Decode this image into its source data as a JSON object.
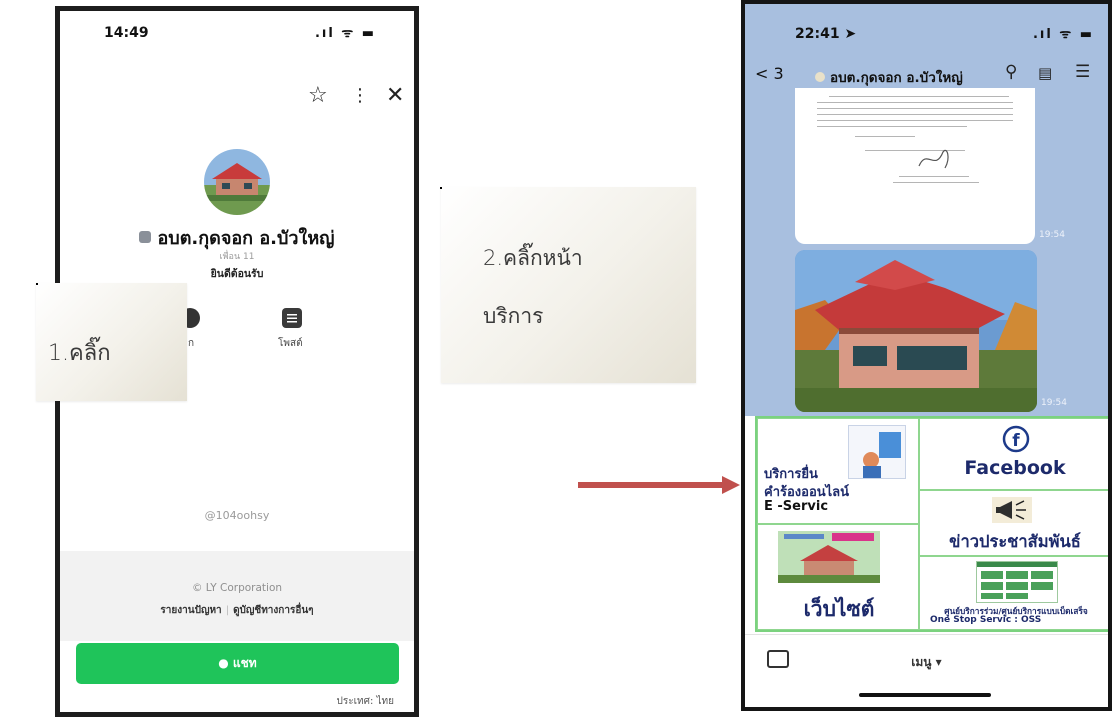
{
  "left_phone": {
    "status_time": "14:49",
    "status_icons": ".ıl ᯤ ▬",
    "profile_name": "อบต.กุดจอก อ.บัวใหญ่",
    "friends_count": "เพื่อน 11",
    "welcome": "ยินดีต้อนรับ",
    "actions": [
      {
        "label": "ก",
        "icon": "chat-icon"
      },
      {
        "label": "โพสต์",
        "icon": "post-icon"
      }
    ],
    "line_id": "@104oohsy",
    "copyright": "© LY Corporation",
    "footer_link_1": "รายงานปัญหา",
    "footer_link_2": "ดูบัญชีทางการอื่นๆ",
    "chat_button": "แชท",
    "country": "ประเทศ: ไทย",
    "header_icons": [
      "star-icon",
      "more-icon",
      "close-icon"
    ]
  },
  "callout_1": "1.คลิ๊ก",
  "callout_2_line1": "2.คลิ๊กหน้า",
  "callout_2_line2": "บริการ",
  "right_phone": {
    "status_time": "22:41",
    "back_count": "3",
    "chat_title": "อบต.กุดจอก อ.บัวใหญ่",
    "message_times": [
      "19:54",
      "19:54"
    ],
    "rich_menu": {
      "e_service_line1": "บริการยื่น",
      "e_service_line2": "คำร้องออนไลน์",
      "e_service_line3": "E -Servic",
      "facebook": "Facebook",
      "news": "ข่าวประชาสัมพันธ์",
      "website": "เว็บไซต์",
      "oss_line1": "ศูนย์บริการร่วม/ศูนย์บริการแบบเบ็ดเสร็จ",
      "oss_line2": "One Stop Servic : OSS"
    },
    "menu_label": "เมนู ▾"
  },
  "colors": {
    "line_green": "#1fc45a",
    "arrow": "#c0504d",
    "chat_bg": "#a8bfdf",
    "rich_menu_text": "#1d2a6b"
  }
}
